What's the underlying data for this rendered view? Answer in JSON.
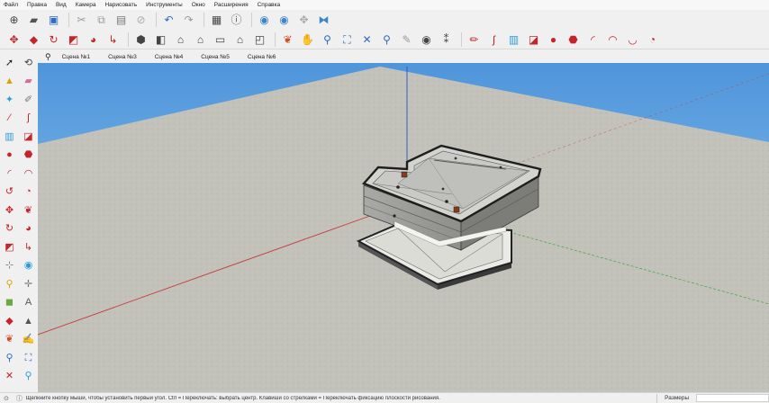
{
  "menu": [
    "Файл",
    "Правка",
    "Вид",
    "Камера",
    "Нарисовать",
    "Инструменты",
    "Окно",
    "Расширения",
    "Справка"
  ],
  "toolbar_row1": [
    {
      "icon": "new-icon",
      "glyph": "⊕",
      "color": "#444444"
    },
    {
      "icon": "open-icon",
      "glyph": "▰",
      "color": "#555555"
    },
    {
      "icon": "save-icon",
      "glyph": "▣",
      "color": "#2d6bc4"
    },
    {
      "sep": true
    },
    {
      "icon": "cut-icon",
      "glyph": "✂",
      "color": "#9a9a9a"
    },
    {
      "icon": "copy-icon",
      "glyph": "⧉",
      "color": "#9a9a9a"
    },
    {
      "icon": "paste-icon",
      "glyph": "▤",
      "color": "#777777"
    },
    {
      "icon": "erase-icon",
      "glyph": "⊘",
      "color": "#aaaaaa"
    },
    {
      "sep": true
    },
    {
      "icon": "undo-icon",
      "glyph": "↶",
      "color": "#2d6bc4"
    },
    {
      "icon": "redo-icon",
      "glyph": "↷",
      "color": "#9a9a9a"
    },
    {
      "sep": true
    },
    {
      "icon": "print-icon",
      "glyph": "▦",
      "color": "#444444"
    },
    {
      "icon": "model-info-icon",
      "glyph": "ⓘ",
      "color": "#555555"
    },
    {
      "sep": true
    },
    {
      "icon": "components-icon",
      "glyph": "◉",
      "color": "#3a86c8"
    },
    {
      "icon": "materials-icon",
      "glyph": "◉",
      "color": "#3a86c8"
    },
    {
      "icon": "styles-icon",
      "glyph": "✥",
      "color": "#aaaaaa"
    },
    {
      "icon": "layers-icon",
      "glyph": "⧓",
      "color": "#3a86c8"
    }
  ],
  "toolbar_row2": [
    {
      "icon": "move-icon",
      "glyph": "✥",
      "color": "#c4252a"
    },
    {
      "icon": "push-pull-icon",
      "glyph": "◆",
      "color": "#c4252a"
    },
    {
      "icon": "rotate-icon",
      "glyph": "↻",
      "color": "#c4252a"
    },
    {
      "icon": "scale-icon",
      "glyph": "◩",
      "color": "#c4252a"
    },
    {
      "icon": "follow-me-icon",
      "glyph": "◕",
      "color": "#c4252a"
    },
    {
      "icon": "offset-icon",
      "glyph": "↳",
      "color": "#c4252a"
    },
    {
      "sep": true
    },
    {
      "icon": "iso-view-icon",
      "glyph": "⬢",
      "color": "#444444"
    },
    {
      "icon": "top-view-icon",
      "glyph": "◧",
      "color": "#444444"
    },
    {
      "icon": "front-view-icon",
      "glyph": "⌂",
      "color": "#444444"
    },
    {
      "icon": "right-view-icon",
      "glyph": "⌂",
      "color": "#444444"
    },
    {
      "icon": "back-view-icon",
      "glyph": "▭",
      "color": "#444444"
    },
    {
      "icon": "left-view-icon",
      "glyph": "⌂",
      "color": "#444444"
    },
    {
      "icon": "bottom-view-icon",
      "glyph": "◰",
      "color": "#444444"
    },
    {
      "sep": true
    },
    {
      "icon": "orbit-icon",
      "glyph": "❦",
      "color": "#d44b1f"
    },
    {
      "icon": "pan-icon",
      "glyph": "✋",
      "color": "#6ca840"
    },
    {
      "icon": "zoom-icon",
      "glyph": "⚲",
      "color": "#2d6bc4"
    },
    {
      "icon": "zoom-window-icon",
      "glyph": "⛶",
      "color": "#2d6bc4"
    },
    {
      "icon": "zoom-extents-icon",
      "glyph": "✕",
      "color": "#2d6bc4"
    },
    {
      "icon": "previous-view-icon",
      "glyph": "⚲",
      "color": "#2d6bc4"
    },
    {
      "icon": "position-camera-icon",
      "glyph": "✎",
      "color": "#9a9a9a"
    },
    {
      "icon": "look-around-icon",
      "glyph": "◉",
      "color": "#444444"
    },
    {
      "icon": "walk-icon",
      "glyph": "⁑",
      "color": "#444444"
    },
    {
      "sep": true
    },
    {
      "icon": "pencil-icon",
      "glyph": "✏",
      "color": "#c4252a"
    },
    {
      "icon": "freehand-icon",
      "glyph": "ʃ",
      "color": "#c4252a"
    },
    {
      "icon": "rectangle-icon",
      "glyph": "▥",
      "color": "#2d9bd6"
    },
    {
      "icon": "rotated-rect-icon",
      "glyph": "◪",
      "color": "#c4252a"
    },
    {
      "icon": "circle-icon",
      "glyph": "●",
      "color": "#c4252a"
    },
    {
      "icon": "polygon-icon",
      "glyph": "⬣",
      "color": "#c4252a"
    },
    {
      "icon": "arc-icon",
      "glyph": "◜",
      "color": "#c4252a"
    },
    {
      "icon": "arc-2pt-icon",
      "glyph": "◠",
      "color": "#c4252a"
    },
    {
      "icon": "arc-3pt-icon",
      "glyph": "◡",
      "color": "#c4252a"
    },
    {
      "icon": "pie-icon",
      "glyph": "◔",
      "color": "#c4252a"
    }
  ],
  "scenes": {
    "search_icon": "search-icon",
    "tabs": [
      "Сцена №1",
      "Сцена №3",
      "Сцена №4",
      "Сцена №5",
      "Сцена №6"
    ]
  },
  "left_tools": [
    {
      "icon": "select-icon",
      "glyph": "➚",
      "color": "#222222"
    },
    {
      "icon": "lasso-icon",
      "glyph": "⟲",
      "color": "#444444"
    },
    {
      "icon": "paint-bucket-icon",
      "glyph": "▲",
      "color": "#d9a400"
    },
    {
      "icon": "eraser-icon",
      "glyph": "▰",
      "color": "#d66aa0"
    },
    {
      "icon": "sandbox-icon",
      "glyph": "✦",
      "color": "#2d9bd6"
    },
    {
      "icon": "tape-measure-icon",
      "glyph": "✐",
      "color": "#777777"
    },
    {
      "icon": "line-icon",
      "glyph": "∕",
      "color": "#c4252a"
    },
    {
      "icon": "freehand-tool-icon",
      "glyph": "ʃ",
      "color": "#c4252a"
    },
    {
      "icon": "rectangle-tool-icon",
      "glyph": "▥",
      "color": "#2d9bd6"
    },
    {
      "icon": "rotated-rect-tool-icon",
      "glyph": "◪",
      "color": "#c4252a"
    },
    {
      "icon": "circle-tool-icon",
      "glyph": "●",
      "color": "#c4252a"
    },
    {
      "icon": "polygon-tool-icon",
      "glyph": "⬣",
      "color": "#c4252a"
    },
    {
      "icon": "arc-tool-icon",
      "glyph": "◜",
      "color": "#c4252a"
    },
    {
      "icon": "arc-2pt-tool-icon",
      "glyph": "◠",
      "color": "#c4252a"
    },
    {
      "icon": "arc-3pt-tool-icon",
      "glyph": "↺",
      "color": "#c4252a"
    },
    {
      "icon": "pie-tool-icon",
      "glyph": "◔",
      "color": "#c4252a"
    },
    {
      "icon": "move-tool-icon",
      "glyph": "✥",
      "color": "#c4252a"
    },
    {
      "icon": "push-pull-tool-icon",
      "glyph": "❦",
      "color": "#c4252a"
    },
    {
      "icon": "rotate-tool-icon",
      "glyph": "↻",
      "color": "#c4252a"
    },
    {
      "icon": "follow-me-tool-icon",
      "glyph": "◕",
      "color": "#c4252a"
    },
    {
      "icon": "scale-tool-icon",
      "glyph": "◩",
      "color": "#c4252a"
    },
    {
      "icon": "offset-tool-icon",
      "glyph": "↳",
      "color": "#c4252a"
    },
    {
      "icon": "tape-icon",
      "glyph": "⊹",
      "color": "#777777"
    },
    {
      "icon": "components-tool-icon",
      "glyph": "◉",
      "color": "#2d9bd6"
    },
    {
      "icon": "protractor-icon",
      "glyph": "⚲",
      "color": "#d9a400"
    },
    {
      "icon": "axes-icon",
      "glyph": "✛",
      "color": "#777777"
    },
    {
      "icon": "dimension-icon",
      "glyph": "◼",
      "color": "#6ca840"
    },
    {
      "icon": "text-icon",
      "glyph": "A",
      "color": "#555555"
    },
    {
      "icon": "section-plane-icon",
      "glyph": "◆",
      "color": "#c4252a"
    },
    {
      "icon": "3d-text-icon",
      "glyph": "▲",
      "color": "#555555"
    },
    {
      "icon": "orbit-tool-icon",
      "glyph": "❦",
      "color": "#d44b1f"
    },
    {
      "icon": "pan-tool-icon",
      "glyph": "✍",
      "color": "#d9a400"
    },
    {
      "icon": "zoom-tool-icon",
      "glyph": "⚲",
      "color": "#2d6bc4"
    },
    {
      "icon": "zoom-window-tool-icon",
      "glyph": "⛶",
      "color": "#2d6bc4"
    },
    {
      "icon": "zoom-extents-tool-icon",
      "glyph": "✕",
      "color": "#c4252a"
    },
    {
      "icon": "walk-tool-icon",
      "glyph": "⚲",
      "color": "#2d9bd6"
    }
  ],
  "status": {
    "hint": "Щелкните кнопку мыши, чтобы установить первый угол. Ctrl = Переключать: выбрать центр. Клавиши со стрелками = Переключать фиксацию плоскости рисования.",
    "measurements_label": "Размеры",
    "measurements_value": ""
  },
  "colors": {
    "sky": "#6da8df",
    "ground": "#c5c5bd",
    "axis_red": "#c8383a",
    "axis_green": "#4caa4c",
    "axis_blue": "#3050c8"
  }
}
